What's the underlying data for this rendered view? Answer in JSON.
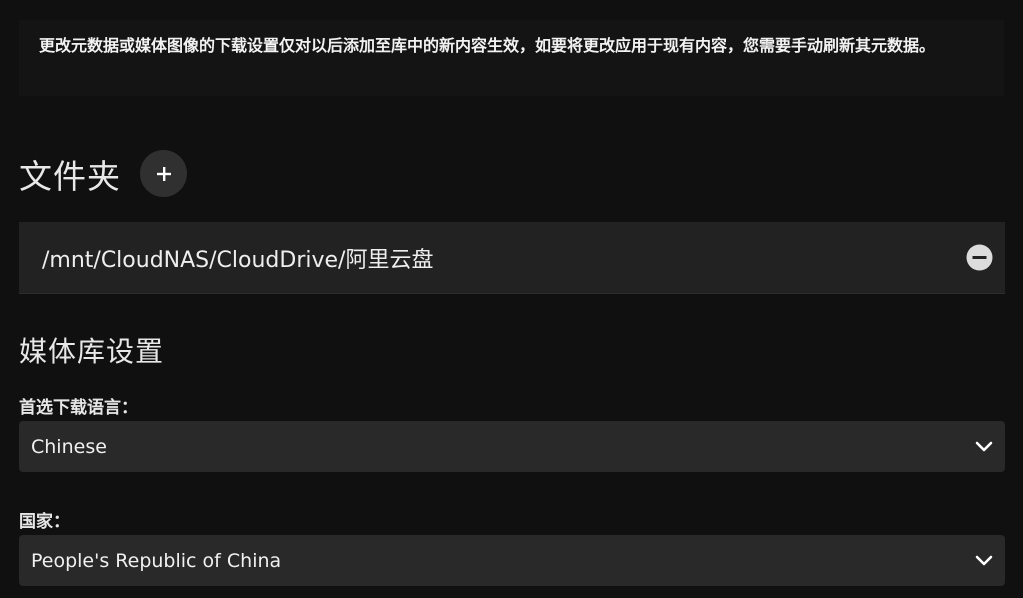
{
  "notice": {
    "text": "更改元数据或媒体图像的下载设置仅对以后添加至库中的新内容生效，如要将更改应用于现有内容，您需要手动刷新其元数据。"
  },
  "folders": {
    "title": "文件夹",
    "add_icon": "plus-icon",
    "items": [
      {
        "path": "/mnt/CloudNAS/CloudDrive/阿里云盘",
        "remove_icon": "minus-circle-icon"
      }
    ]
  },
  "library_settings": {
    "title": "媒体库设置",
    "language": {
      "label": "首选下载语言：",
      "value": "Chinese"
    },
    "country": {
      "label": "国家：",
      "value": "People's Republic of China"
    }
  },
  "colors": {
    "background": "#101010",
    "panel": "#222222",
    "select": "#292929",
    "button": "#303030"
  }
}
